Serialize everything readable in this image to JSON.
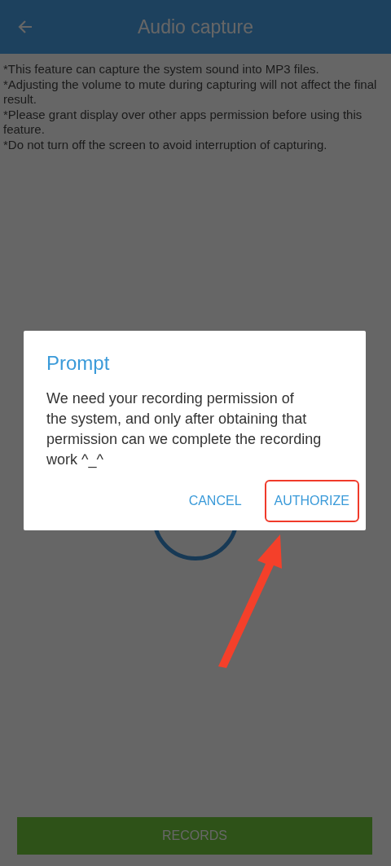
{
  "app_bar": {
    "title": "Audio capture"
  },
  "notes": [
    "*This feature can capture the system sound into MP3 files.",
    "*Adjusting the volume to mute during capturing will not affect the final result.",
    "*Please grant display over other apps permission before using this feature.",
    "*Do not turn off the screen to avoid interruption of capturing."
  ],
  "records_button": {
    "label": "RECORDS"
  },
  "dialog": {
    "title": "Prompt",
    "message": "We need your recording permission of\nthe system, and only after obtaining that permission can we complete the recording work ^_^",
    "actions": [
      {
        "label": "CANCEL",
        "highlighted": false
      },
      {
        "label": "AUTHORIZE",
        "highlighted": true
      }
    ]
  },
  "annotation": {
    "kind": "arrow"
  }
}
